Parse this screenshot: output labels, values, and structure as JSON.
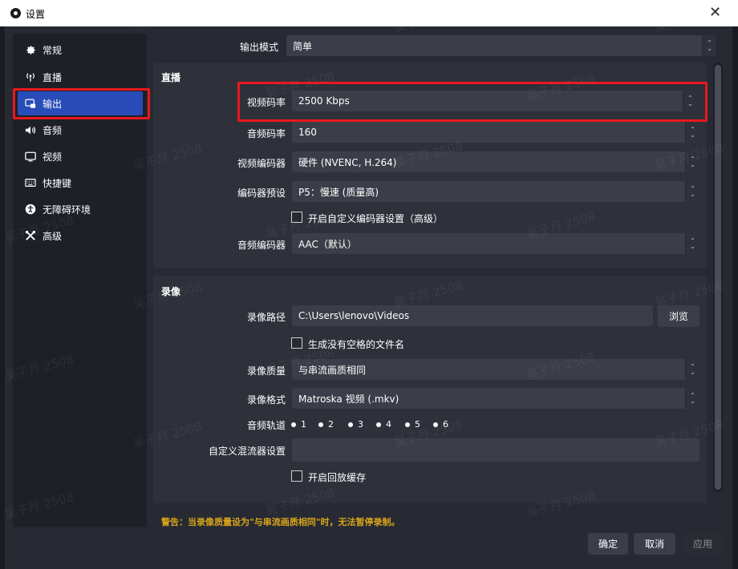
{
  "window": {
    "title": "设置",
    "close_glyph": "✕"
  },
  "sidebar": {
    "items": [
      {
        "label": "常规",
        "icon": "gear-icon"
      },
      {
        "label": "直播",
        "icon": "antenna-icon"
      },
      {
        "label": "输出",
        "icon": "output-icon",
        "active": true
      },
      {
        "label": "音频",
        "icon": "speaker-icon"
      },
      {
        "label": "视频",
        "icon": "monitor-icon"
      },
      {
        "label": "快捷键",
        "icon": "keyboard-icon"
      },
      {
        "label": "无障碍环境",
        "icon": "accessibility-icon"
      },
      {
        "label": "高级",
        "icon": "wrench-icon"
      }
    ]
  },
  "output_mode": {
    "label": "输出模式",
    "value": "简单"
  },
  "streaming": {
    "title": "直播",
    "video_bitrate": {
      "label": "视频码率",
      "value": "2500 Kbps"
    },
    "audio_bitrate": {
      "label": "音频码率",
      "value": "160"
    },
    "video_encoder": {
      "label": "视频编码器",
      "value": "硬件 (NVENC, H.264)"
    },
    "encoder_preset": {
      "label": "编码器预设",
      "value": "P5：慢速 (质量高)"
    },
    "custom_encoder": {
      "label": "开启自定义编码器设置（高级）"
    },
    "audio_encoder": {
      "label": "音频编码器",
      "value": "AAC（默认）"
    }
  },
  "recording": {
    "title": "录像",
    "path": {
      "label": "录像路径",
      "value": "C:\\Users\\lenovo\\Videos",
      "browse": "浏览"
    },
    "no_space": {
      "label": "生成没有空格的文件名"
    },
    "quality": {
      "label": "录像质量",
      "value": "与串流画质相同"
    },
    "format": {
      "label": "录像格式",
      "value": "Matroska 视频 (.mkv)"
    },
    "tracks": {
      "label": "音频轨道",
      "items": [
        "1",
        "2",
        "3",
        "4",
        "5",
        "6"
      ]
    },
    "muxer": {
      "label": "自定义混流器设置",
      "value": ""
    },
    "replay": {
      "label": "开启回放缓存"
    }
  },
  "warning": "警告：当录像质量设为\"与串流画质相同\"时，无法暂停录制。",
  "buttons": {
    "ok": "确定",
    "cancel": "取消",
    "apply": "应用"
  },
  "colors": {
    "accent": "#284cb8",
    "highlight": "#e8191d",
    "warning": "#d9a51a"
  },
  "watermark": "吴子月 2508"
}
